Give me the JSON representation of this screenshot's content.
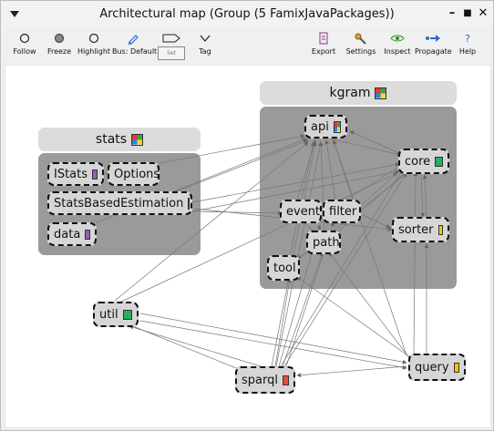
{
  "window": {
    "title": "Architectural map (Group (5 FamixJavaPackages))",
    "controls": {
      "minimize": "–",
      "maximize": "■",
      "close": "✕"
    }
  },
  "toolbar": {
    "follow": "Follow",
    "freeze": "Freeze",
    "highlight": "Highlight",
    "bus": "Bus: Default",
    "set": "Set",
    "tag": "Tag",
    "export": "Export",
    "settings": "Settings",
    "inspect": "Inspect",
    "propagate": "Propagate",
    "help": "Help"
  },
  "groups": {
    "stats": {
      "title": "stats"
    },
    "kgram": {
      "title": "kgram"
    }
  },
  "nodes": {
    "istats": "IStats",
    "options": "Options",
    "statsbased": "StatsBasedEstimation",
    "data": "data",
    "api": "api",
    "core": "core",
    "event": "event",
    "filter": "filter",
    "path": "path",
    "sorter": "sorter",
    "tool": "tool",
    "util": "util",
    "sparql": "sparql",
    "query": "query"
  },
  "tag_colors": {
    "purple": "#9c59b6",
    "green": "#27ae60",
    "yellow": "#f1c40f",
    "red": "#e74c3c"
  }
}
